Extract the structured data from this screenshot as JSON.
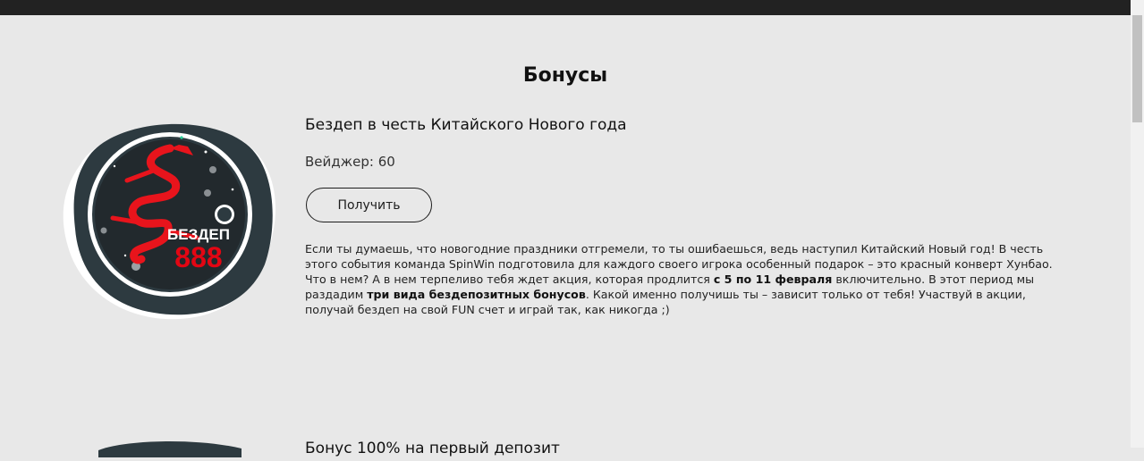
{
  "page": {
    "title": "Бонусы"
  },
  "bonus": {
    "badge_label": "БЕЗДЕП",
    "badge_number": "888",
    "title": "Бездеп в честь Китайского Нового года",
    "wager": "Вейджер: 60",
    "button_label": "Получить",
    "description": {
      "p1": "Если ты думаешь, что новогодние праздники отгремели, то ты ошибаешься, ведь наступил Китайский Новый год! В честь этого события команда SpinWin подготовила для каждого своего игрока особенный подарок – это красный конверт Хунбао. Что в нем? А в нем терпеливо тебя ждет акция, которая продлится ",
      "b1": "с 5 по 11 февраля",
      "p2": " включительно. В этот период мы раздадим ",
      "b2": "три вида бездепозитных бонусов",
      "p3": ". Какой именно получишь ты – зависит только от тебя! Участвуй в акции, получай бездеп на свой FUN счет и играй так, как никогда ;)"
    }
  },
  "next_bonus": {
    "title": "Бонус 100% на первый депозит"
  },
  "colors": {
    "badge_dark": "#2d3a40",
    "badge_red": "#e30613",
    "dragon_red": "#e8141c"
  }
}
